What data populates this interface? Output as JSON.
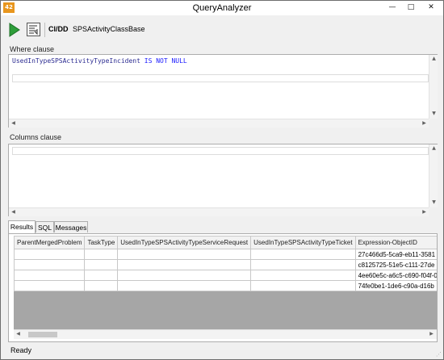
{
  "window": {
    "app_icon_text": "42",
    "title": "QueryAnalyzer",
    "minimize_glyph": "—",
    "maximize_glyph": "□",
    "close_glyph": "✕"
  },
  "toolbar": {
    "run_icon": "play-icon",
    "options_icon": "settings-list-icon",
    "cidd_label": "CI/DD",
    "cidd_value": "SPSActivityClassBase"
  },
  "where": {
    "label": "Where clause",
    "code_column": "UsedInTypeSPSActivityTypeIncident",
    "code_keywords": " IS NOT NULL"
  },
  "columns": {
    "label": "Columns clause"
  },
  "tabs": [
    "Results",
    "SQL",
    "Messages"
  ],
  "results": {
    "columns": [
      "ParentMergedProblem",
      "TaskType",
      "UsedInTypeSPSActivityTypeServiceRequest",
      "UsedInTypeSPSActivityTypeTicket",
      "Expression-ObjectID"
    ],
    "rows": [
      [
        "",
        "",
        "",
        "",
        "27c466d5-5ca9-eb11-3581"
      ],
      [
        "",
        "",
        "",
        "",
        "c8125725-51e5-c111-27de"
      ],
      [
        "",
        "",
        "",
        "",
        "4ee60e5c-a6c5-c690-f04f-0"
      ],
      [
        "",
        "",
        "",
        "",
        "74fe0be1-1de6-c90a-d16b"
      ]
    ]
  },
  "status": {
    "text": "Ready"
  },
  "colors": {
    "app_icon": "#e8961e",
    "run_green": "#2e9e3a",
    "keyword_blue": "#1a1aff"
  }
}
